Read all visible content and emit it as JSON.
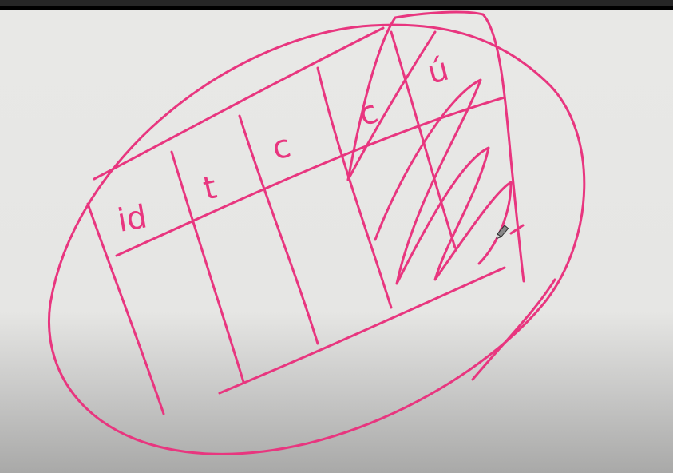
{
  "ink_color": "#e8367f",
  "board_color": "#e8e8e6",
  "header_labels": [
    "id",
    "t",
    "c",
    "c",
    "ú"
  ],
  "cursor_icon": "pencil-cursor-icon"
}
